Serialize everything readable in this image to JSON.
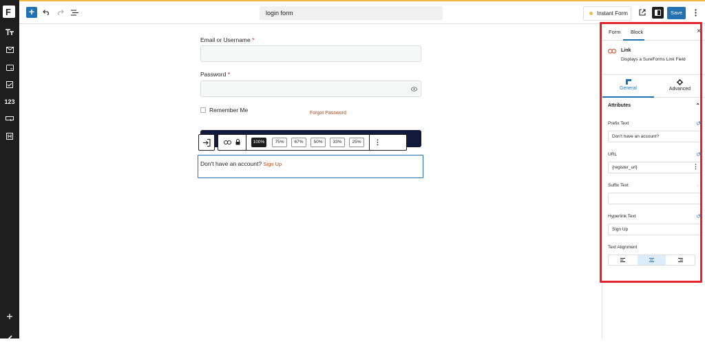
{
  "topbar": {
    "search_value": "login form",
    "instant_form_label": "Instant Form",
    "save_label": "Save"
  },
  "leftbar": {
    "numbers_label": "123"
  },
  "form": {
    "email_label": "Email or Username",
    "email_required": "*",
    "password_label": "Password",
    "password_required": "*",
    "remember_label": "Remember Me",
    "forgot_label": "Forgot Password",
    "link_block_prefix": "Don't have an account?",
    "link_block_link": "Sign Up"
  },
  "block_toolbar": {
    "widths": [
      "100%",
      "75%",
      "67%",
      "50%",
      "33%",
      "25%"
    ],
    "active_width": "100%"
  },
  "panel": {
    "tab_form": "Form",
    "tab_block": "Block",
    "close_symbol": "×",
    "block_title": "Link",
    "block_desc": "Displays a SureForms Link Field",
    "subtab_general": "General",
    "subtab_advanced": "Advanced",
    "section_attributes": "Attributes",
    "prefix_label": "Prefix Text",
    "prefix_value": "Don't have an account?",
    "url_label": "URL",
    "url_value": "{register_url}",
    "suffix_label": "Suffix Text",
    "suffix_value": "",
    "hyperlink_label": "Hyperlink Text",
    "hyperlink_value": "Sign Up",
    "alignment_label": "Text Alignment",
    "alignment_selected": "center"
  },
  "colors": {
    "accent": "#2271b1",
    "highlight": "#e5212b",
    "link": "#b9420f",
    "button_dark": "#111a3a"
  }
}
